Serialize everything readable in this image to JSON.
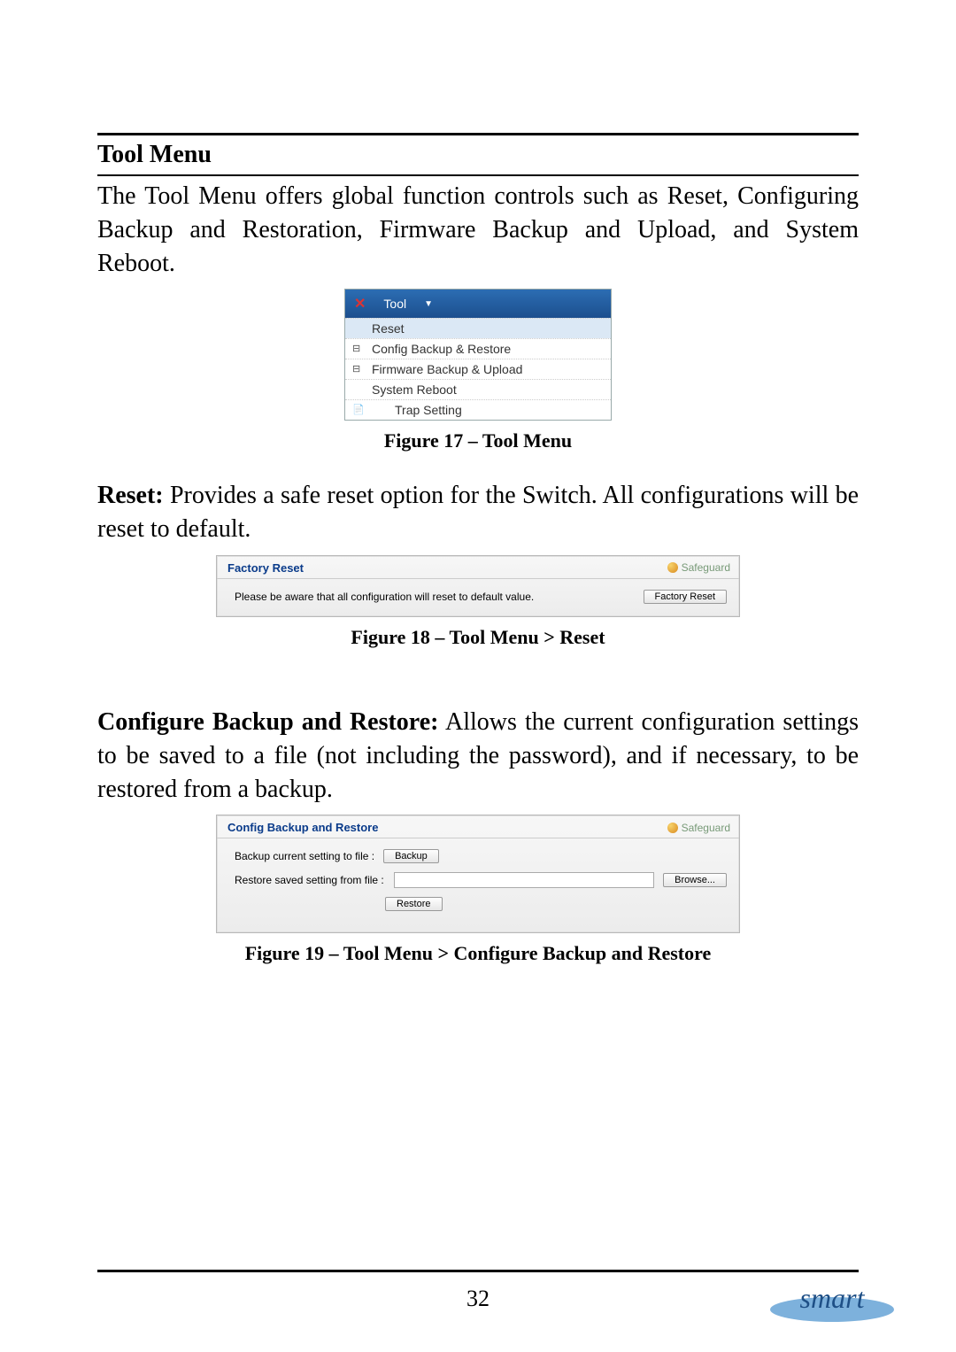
{
  "header": {
    "title": "Tool Menu"
  },
  "intro": "The Tool Menu offers global function controls such as Reset, Configuring Backup and Restoration, Firmware Backup and Upload, and System Reboot.",
  "fig17": {
    "menu_label": "Tool",
    "items": [
      "Reset",
      "Config Backup & Restore",
      "Firmware Backup & Upload",
      "System Reboot"
    ],
    "sub_item": "Trap Setting",
    "caption": "Figure 17 – Tool Menu"
  },
  "reset_section": {
    "label": "Reset:",
    "text": " Provides a safe reset option for the Switch. All configurations will be reset to default."
  },
  "fig18": {
    "panel_title": "Factory Reset",
    "safeguard": "Safeguard",
    "warning": "Please be aware that all configuration will reset to default value.",
    "button": "Factory Reset",
    "caption": "Figure 18 – Tool Menu > Reset"
  },
  "backup_section": {
    "label": "Configure Backup and Restore:",
    "text": " Allows the current configuration settings to be saved to a file (not including the password), and if necessary, to be restored from a backup."
  },
  "fig19": {
    "panel_title": "Config Backup and Restore",
    "safeguard": "Safeguard",
    "row1_label": "Backup current setting to file :",
    "btn_backup": "Backup",
    "row2_label": "Restore saved setting from file :",
    "btn_browse": "Browse...",
    "btn_restore": "Restore",
    "caption": "Figure 19 – Tool Menu > Configure Backup and Restore"
  },
  "page_number": "32",
  "logo_text": "smart"
}
